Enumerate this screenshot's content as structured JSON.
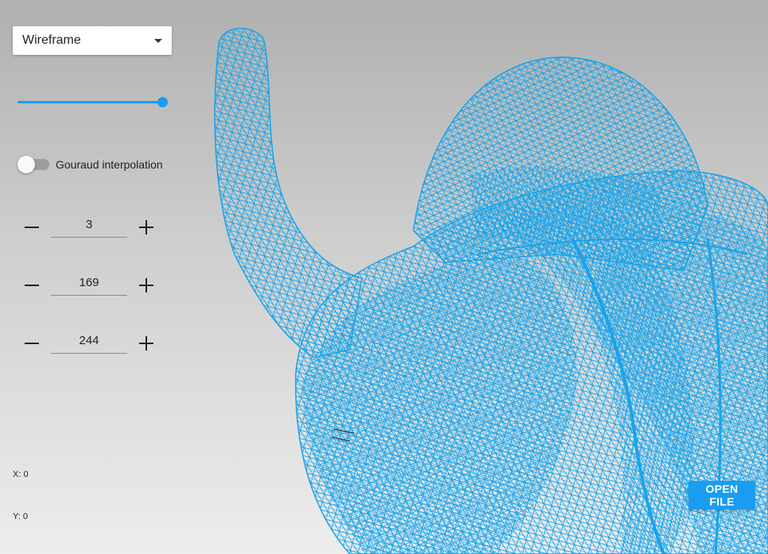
{
  "render_mode": {
    "selected": "Wireframe"
  },
  "slider": {
    "fraction": 1.0
  },
  "gouraud": {
    "label": "Gouraud interpolation",
    "enabled": false
  },
  "steppers": [
    {
      "value": "3"
    },
    {
      "value": "169"
    },
    {
      "value": "244"
    }
  ],
  "coords": {
    "x": "X: 0",
    "y": "Y: 0"
  },
  "open_file": {
    "label": "OPEN FILE"
  },
  "colors": {
    "accent": "#1a9df0",
    "mesh": "#1aa3e8",
    "mesh_dark": "#0d1b26"
  }
}
